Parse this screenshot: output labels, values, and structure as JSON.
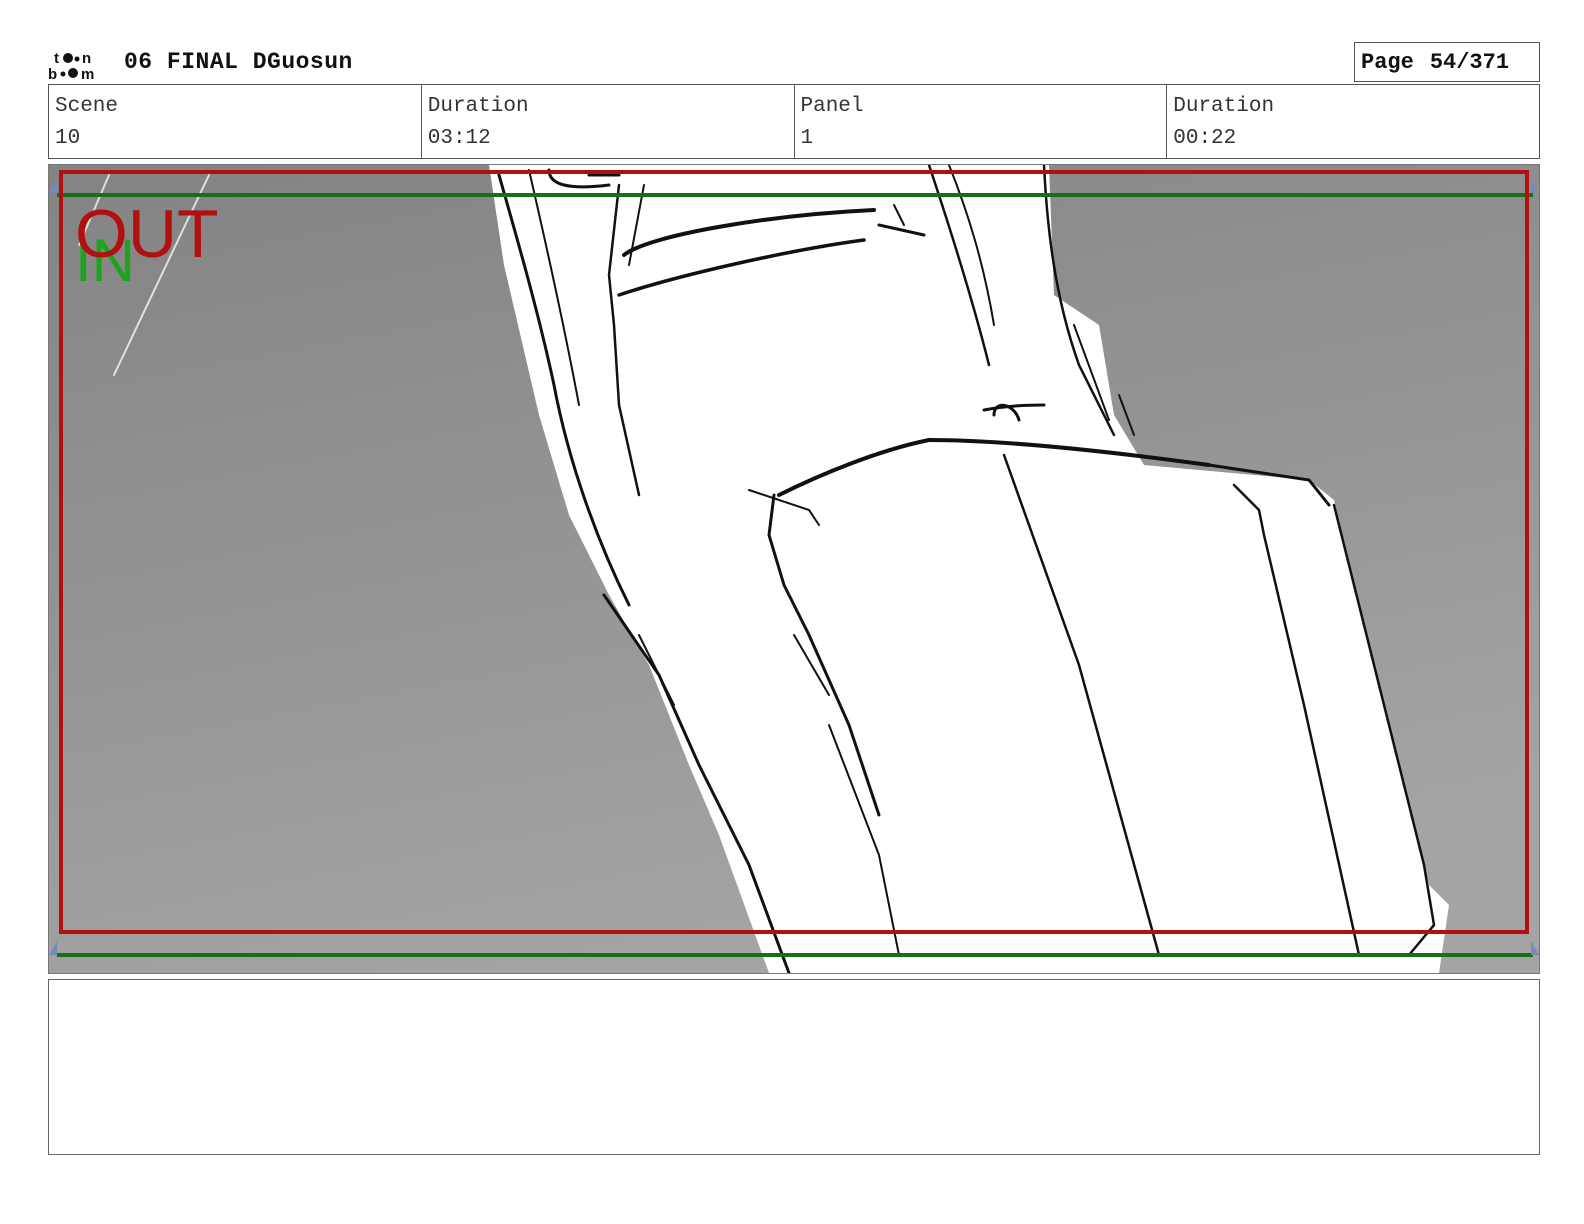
{
  "header": {
    "logo_text": "toon boom",
    "title": "06 FINAL DGuosun",
    "page_label": "Page",
    "page_number": "54/371"
  },
  "info": {
    "scene_label": "Scene",
    "scene_value": "10",
    "scene_duration_label": "Duration",
    "scene_duration_value": "03:12",
    "panel_label": "Panel",
    "panel_value": "1",
    "panel_duration_label": "Duration",
    "panel_duration_value": "00:22"
  },
  "panel_overlay": {
    "out_label": "OUT",
    "in_label": "IN",
    "out_color": "#b01010",
    "in_color": "#1aa51a",
    "safe_frame_color": "#1a6e1a"
  },
  "notes": {
    "text": ""
  }
}
